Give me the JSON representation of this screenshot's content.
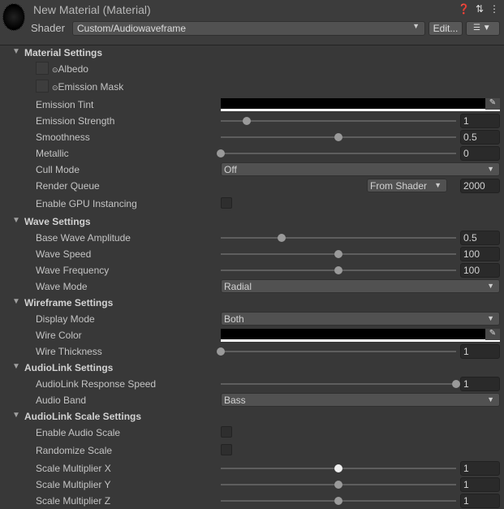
{
  "header": {
    "title": "New Material (Material)",
    "shader_label": "Shader",
    "shader_value": "Custom/Audiowaveframe",
    "edit_label": "Edit...",
    "icons": [
      "help-icon",
      "preset-icon",
      "more-icon"
    ]
  },
  "rows": [
    {
      "type": "section",
      "label": "Material Settings"
    },
    {
      "type": "texture",
      "label": "Albedo"
    },
    {
      "type": "texture",
      "label": "Emission Mask"
    },
    {
      "type": "color",
      "label": "Emission Tint",
      "color": "#000000"
    },
    {
      "type": "slider",
      "label": "Emission Strength",
      "value": "1",
      "fraction": 0.11
    },
    {
      "type": "slider",
      "label": "Smoothness",
      "value": "0.5",
      "fraction": 0.5
    },
    {
      "type": "slider",
      "label": "Metallic",
      "value": "0",
      "fraction": 0
    },
    {
      "type": "dropdown",
      "label": "Cull Mode",
      "value": "Off"
    },
    {
      "type": "queue",
      "label": "Render Queue",
      "value": "From Shader",
      "number": "2000"
    },
    {
      "type": "checkbox",
      "label": "Enable GPU Instancing",
      "checked": false
    },
    {
      "type": "section",
      "label": "Wave Settings"
    },
    {
      "type": "slider",
      "label": "Base Wave Amplitude",
      "value": "0.5",
      "fraction": 0.26
    },
    {
      "type": "slider",
      "label": "Wave Speed",
      "value": "100",
      "fraction": 0.5
    },
    {
      "type": "slider",
      "label": "Wave Frequency",
      "value": "100",
      "fraction": 0.5
    },
    {
      "type": "dropdown",
      "label": "Wave Mode",
      "value": "Radial"
    },
    {
      "type": "section",
      "label": "Wireframe Settings"
    },
    {
      "type": "dropdown",
      "label": "Display Mode",
      "value": "Both"
    },
    {
      "type": "color",
      "label": "Wire Color",
      "color": "#000000"
    },
    {
      "type": "slider",
      "label": "Wire Thickness",
      "value": "1",
      "fraction": 0
    },
    {
      "type": "section",
      "label": "AudioLink Settings"
    },
    {
      "type": "slider",
      "label": "AudioLink Response Speed",
      "value": "1",
      "fraction": 1
    },
    {
      "type": "dropdown",
      "label": "Audio Band",
      "value": "Bass"
    },
    {
      "type": "section",
      "label": "AudioLink Scale Settings"
    },
    {
      "type": "checkbox",
      "label": "Enable Audio Scale",
      "checked": false
    },
    {
      "type": "checkbox",
      "label": "Randomize Scale",
      "checked": false
    },
    {
      "type": "slider",
      "label": "Scale Multiplier X",
      "value": "1",
      "fraction": 0.5,
      "hover": true
    },
    {
      "type": "slider",
      "label": "Scale Multiplier Y",
      "value": "1",
      "fraction": 0.5
    },
    {
      "type": "slider",
      "label": "Scale Multiplier Z",
      "value": "1",
      "fraction": 0.5
    }
  ]
}
